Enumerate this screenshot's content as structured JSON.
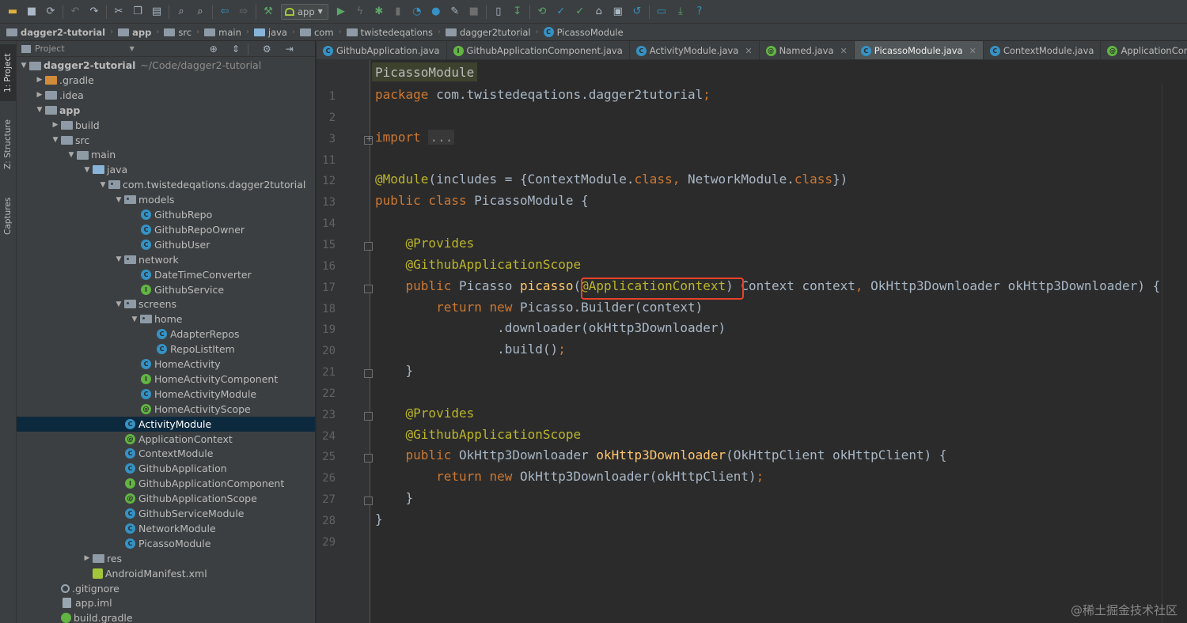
{
  "toolbar": {
    "run_config": "app"
  },
  "breadcrumb": [
    "dagger2-tutorial",
    "app",
    "src",
    "main",
    "java",
    "com",
    "twistedeqations",
    "dagger2tutorial",
    "PicassoModule"
  ],
  "side_stripe": {
    "project": "1: Project",
    "structure": "Z: Structure",
    "captures": "Captures"
  },
  "project_panel": {
    "title": "Project",
    "tree": [
      {
        "label": "dagger2-tutorial",
        "muted": "~/Code/dagger2-tutorial",
        "depth": 0,
        "arrow": "open",
        "icon": "folder",
        "bold": true
      },
      {
        "label": ".gradle",
        "depth": 1,
        "arrow": "closed",
        "icon": "folder-orange"
      },
      {
        "label": ".idea",
        "depth": 1,
        "arrow": "closed",
        "icon": "folder"
      },
      {
        "label": "app",
        "depth": 1,
        "arrow": "open",
        "icon": "folder",
        "bold": true
      },
      {
        "label": "build",
        "depth": 2,
        "arrow": "closed",
        "icon": "folder"
      },
      {
        "label": "src",
        "depth": 2,
        "arrow": "open",
        "icon": "folder"
      },
      {
        "label": "main",
        "depth": 3,
        "arrow": "open",
        "icon": "folder"
      },
      {
        "label": "java",
        "depth": 4,
        "arrow": "open",
        "icon": "folder-blue"
      },
      {
        "label": "com.twistedeqations.dagger2tutorial",
        "depth": 5,
        "arrow": "open",
        "icon": "pkg"
      },
      {
        "label": "models",
        "depth": 6,
        "arrow": "open",
        "icon": "pkg"
      },
      {
        "label": "GithubRepo",
        "depth": 7,
        "arrow": "",
        "icon": "c"
      },
      {
        "label": "GithubRepoOwner",
        "depth": 7,
        "arrow": "",
        "icon": "c"
      },
      {
        "label": "GithubUser",
        "depth": 7,
        "arrow": "",
        "icon": "c"
      },
      {
        "label": "network",
        "depth": 6,
        "arrow": "open",
        "icon": "pkg"
      },
      {
        "label": "DateTimeConverter",
        "depth": 7,
        "arrow": "",
        "icon": "c"
      },
      {
        "label": "GithubService",
        "depth": 7,
        "arrow": "",
        "icon": "i"
      },
      {
        "label": "screens",
        "depth": 6,
        "arrow": "open",
        "icon": "pkg"
      },
      {
        "label": "home",
        "depth": 7,
        "arrow": "open",
        "icon": "pkg"
      },
      {
        "label": "AdapterRepos",
        "depth": 8,
        "arrow": "",
        "icon": "c"
      },
      {
        "label": "RepoListItem",
        "depth": 8,
        "arrow": "",
        "icon": "c"
      },
      {
        "label": "HomeActivity",
        "depth": 7,
        "arrow": "",
        "icon": "c"
      },
      {
        "label": "HomeActivityComponent",
        "depth": 7,
        "arrow": "",
        "icon": "i"
      },
      {
        "label": "HomeActivityModule",
        "depth": 7,
        "arrow": "",
        "icon": "c"
      },
      {
        "label": "HomeActivityScope",
        "depth": 7,
        "arrow": "",
        "icon": "at"
      },
      {
        "label": "ActivityModule",
        "depth": 6,
        "arrow": "",
        "icon": "c",
        "selected": true
      },
      {
        "label": "ApplicationContext",
        "depth": 6,
        "arrow": "",
        "icon": "at"
      },
      {
        "label": "ContextModule",
        "depth": 6,
        "arrow": "",
        "icon": "c"
      },
      {
        "label": "GithubApplication",
        "depth": 6,
        "arrow": "",
        "icon": "c"
      },
      {
        "label": "GithubApplicationComponent",
        "depth": 6,
        "arrow": "",
        "icon": "i"
      },
      {
        "label": "GithubApplicationScope",
        "depth": 6,
        "arrow": "",
        "icon": "at"
      },
      {
        "label": "GithubServiceModule",
        "depth": 6,
        "arrow": "",
        "icon": "c"
      },
      {
        "label": "NetworkModule",
        "depth": 6,
        "arrow": "",
        "icon": "c"
      },
      {
        "label": "PicassoModule",
        "depth": 6,
        "arrow": "",
        "icon": "c"
      },
      {
        "label": "res",
        "depth": 4,
        "arrow": "closed",
        "icon": "folder"
      },
      {
        "label": "AndroidManifest.xml",
        "depth": 4,
        "arrow": "",
        "icon": "manifest"
      },
      {
        "label": ".gitignore",
        "depth": 2,
        "arrow": "",
        "icon": "git"
      },
      {
        "label": "app.iml",
        "depth": 2,
        "arrow": "",
        "icon": "file"
      },
      {
        "label": "build.gradle",
        "depth": 2,
        "arrow": "",
        "icon": "gradle"
      }
    ]
  },
  "editor_tabs": [
    {
      "label": "GithubApplication.java",
      "icon": "c"
    },
    {
      "label": "GithubApplicationComponent.java",
      "icon": "i"
    },
    {
      "label": "ActivityModule.java",
      "icon": "c",
      "close": true
    },
    {
      "label": "Named.java",
      "icon": "at",
      "close": true
    },
    {
      "label": "PicassoModule.java",
      "icon": "c",
      "close": true,
      "active": true
    },
    {
      "label": "ContextModule.java",
      "icon": "c"
    },
    {
      "label": "ApplicationContext.java",
      "icon": "at"
    }
  ],
  "editor": {
    "nav_chip": "PicassoModule",
    "lines": [
      {
        "n": "1",
        "fold": "",
        "tokens": [
          [
            "kw",
            "package "
          ],
          [
            "",
            "com.twistedeqations.dagger2tutorial"
          ],
          [
            "kw",
            ";"
          ]
        ]
      },
      {
        "n": "2",
        "fold": "",
        "tokens": []
      },
      {
        "n": "3",
        "fold": "plus",
        "tokens": [
          [
            "kw",
            "import "
          ],
          [
            "dots",
            "..."
          ]
        ]
      },
      {
        "n": "11",
        "fold": "",
        "tokens": []
      },
      {
        "n": "12",
        "fold": "",
        "tokens": [
          [
            "ann",
            "@Module"
          ],
          [
            "",
            "(includes = {ContextModule."
          ],
          [
            "kw",
            "class"
          ],
          [
            "kw",
            ", "
          ],
          [
            "",
            "NetworkModule."
          ],
          [
            "kw",
            "class"
          ],
          [
            "",
            "})"
          ]
        ]
      },
      {
        "n": "13",
        "fold": "",
        "tokens": [
          [
            "kw",
            "public class "
          ],
          [
            "",
            "PicassoModule {"
          ]
        ]
      },
      {
        "n": "14",
        "fold": "",
        "tokens": []
      },
      {
        "n": "15",
        "fold": "box",
        "tokens": [
          [
            "",
            "    "
          ],
          [
            "ann",
            "@Provides"
          ]
        ]
      },
      {
        "n": "16",
        "fold": "",
        "tokens": [
          [
            "",
            "    "
          ],
          [
            "ann",
            "@GithubApplicationScope"
          ]
        ]
      },
      {
        "n": "17",
        "fold": "box",
        "tokens": [
          [
            "",
            "    "
          ],
          [
            "kw",
            "public "
          ],
          [
            "",
            "Picasso "
          ],
          [
            "fn",
            "picasso"
          ],
          [
            "",
            "("
          ],
          [
            "ann",
            "@ApplicationContext"
          ],
          [
            "",
            ") Context context"
          ],
          [
            "kw",
            ", "
          ],
          [
            "",
            "OkHttp3Downloader okHttp3Downloader) {"
          ]
        ]
      },
      {
        "n": "18",
        "fold": "",
        "tokens": [
          [
            "",
            "        "
          ],
          [
            "kw",
            "return new "
          ],
          [
            "",
            "Picasso.Builder(context)"
          ]
        ]
      },
      {
        "n": "19",
        "fold": "",
        "tokens": [
          [
            "",
            "                .downloader(okHttp3Downloader)"
          ]
        ]
      },
      {
        "n": "20",
        "fold": "",
        "tokens": [
          [
            "",
            "                .build()"
          ],
          [
            "kw",
            ";"
          ]
        ]
      },
      {
        "n": "21",
        "fold": "box",
        "tokens": [
          [
            "",
            "    }"
          ]
        ]
      },
      {
        "n": "22",
        "fold": "",
        "tokens": []
      },
      {
        "n": "23",
        "fold": "box",
        "tokens": [
          [
            "",
            "    "
          ],
          [
            "ann",
            "@Provides"
          ]
        ]
      },
      {
        "n": "24",
        "fold": "",
        "tokens": [
          [
            "",
            "    "
          ],
          [
            "ann",
            "@GithubApplicationScope"
          ]
        ]
      },
      {
        "n": "25",
        "fold": "box",
        "tokens": [
          [
            "",
            "    "
          ],
          [
            "kw",
            "public "
          ],
          [
            "",
            "OkHttp3Downloader "
          ],
          [
            "fn",
            "okHttp3Downloader"
          ],
          [
            "",
            "(OkHttpClient okHttpClient) {"
          ]
        ]
      },
      {
        "n": "26",
        "fold": "",
        "tokens": [
          [
            "",
            "        "
          ],
          [
            "kw",
            "return new "
          ],
          [
            "",
            "OkHttp3Downloader(okHttpClient)"
          ],
          [
            "kw",
            ";"
          ]
        ]
      },
      {
        "n": "27",
        "fold": "box",
        "tokens": [
          [
            "",
            "    }"
          ]
        ]
      },
      {
        "n": "28",
        "fold": "",
        "tokens": [
          [
            "",
            "}"
          ]
        ]
      },
      {
        "n": "29",
        "fold": "",
        "tokens": []
      }
    ]
  },
  "watermark": "@稀土掘金技术社区"
}
